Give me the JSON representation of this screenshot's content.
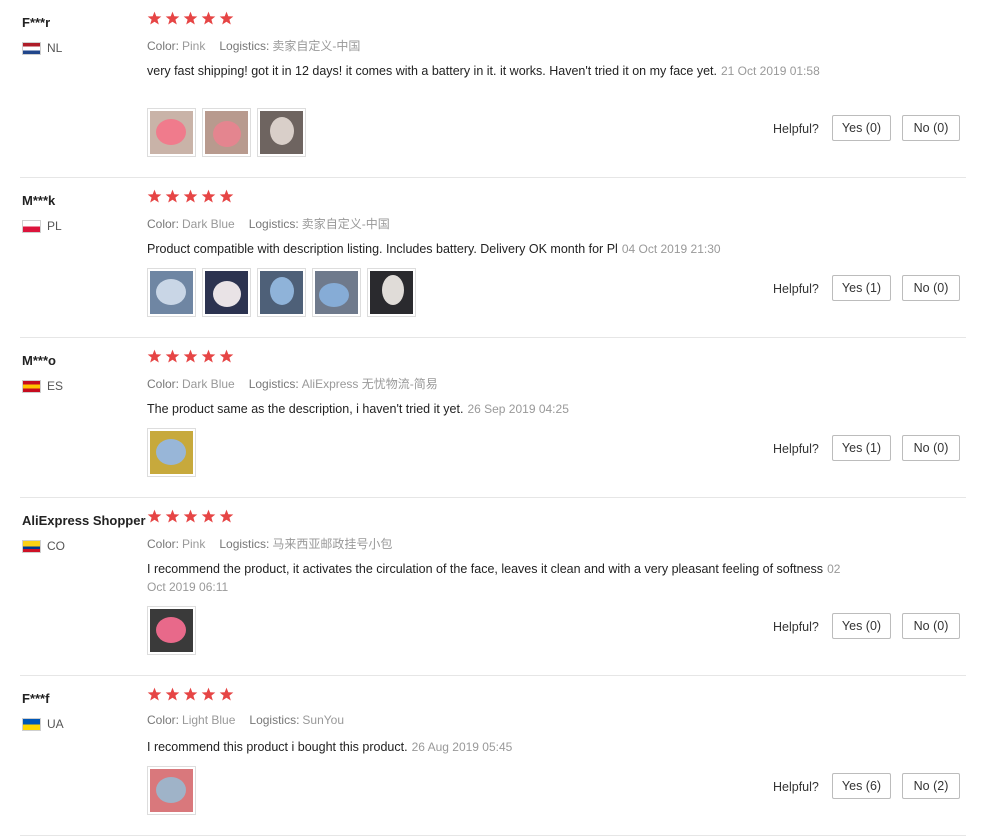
{
  "star_color": "#e64545",
  "helpful_label": "Helpful?",
  "reviews": [
    {
      "user": "F***r",
      "country": "NL",
      "flag_colors": [
        "#ae1c28",
        "#ffffff",
        "#21468b"
      ],
      "color_label": "Color:",
      "color_value": "Pink",
      "logistics_label": "Logistics:",
      "logistics_value": "卖家自定义-中国",
      "text": "very fast shipping! got it in 12 days! it comes with a battery in it. it works. Haven't tried it on my face yet.",
      "date": "21 Oct 2019 01:58",
      "stars": 5,
      "yes_label": "Yes (0)",
      "no_label": "No (0)",
      "thumbs": [
        {
          "bg": "#c9b3a8",
          "fg": "#f07b8c",
          "name": "pink-brush-photo"
        },
        {
          "bg": "#b89a8e",
          "fg": "#e4858f",
          "name": "pink-brush-photo"
        },
        {
          "bg": "#6e6460",
          "fg": "#d9cfc9",
          "name": "package-photo"
        }
      ]
    },
    {
      "user": "M***k",
      "country": "PL",
      "flag_colors": [
        "#ffffff",
        "#dc143c"
      ],
      "color_label": "Color:",
      "color_value": "Dark Blue",
      "logistics_label": "Logistics:",
      "logistics_value": "卖家自定义-中国",
      "text": "Product compatible with description listing. Includes battery. Delivery OK month for Pl",
      "date": "04 Oct 2019 21:30",
      "stars": 5,
      "yes_label": "Yes (1)",
      "no_label": "No (0)",
      "thumbs": [
        {
          "bg": "#6f86a3",
          "fg": "#c9d6e6",
          "name": "blue-brush-photo"
        },
        {
          "bg": "#2c3350",
          "fg": "#e9e3e6",
          "name": "box-photo"
        },
        {
          "bg": "#4e6078",
          "fg": "#8fb3d9",
          "name": "blue-brush-photo"
        },
        {
          "bg": "#6f7a8c",
          "fg": "#86acd6",
          "name": "blue-brush-photo"
        },
        {
          "bg": "#2a2a2e",
          "fg": "#e0dcd8",
          "name": "brush-back-photo"
        }
      ]
    },
    {
      "user": "M***o",
      "country": "ES",
      "flag_colors": [
        "#c60b1e",
        "#ffc400",
        "#c60b1e"
      ],
      "color_label": "Color:",
      "color_value": "Dark Blue",
      "logistics_label": "Logistics:",
      "logistics_value": "AliExpress 无忧物流-简易",
      "text": "The product same as the description, i haven't tried it yet.",
      "date": "26 Sep 2019 04:25",
      "stars": 5,
      "yes_label": "Yes (1)",
      "no_label": "No (0)",
      "thumbs": [
        {
          "bg": "#c7a93c",
          "fg": "#98b6d8",
          "name": "blue-brush-photo"
        }
      ]
    },
    {
      "user": "AliExpress Shopper",
      "country": "CO",
      "flag_colors": [
        "#fcd116",
        "#003893",
        "#ce1126"
      ],
      "color_label": "Color:",
      "color_value": "Pink",
      "logistics_label": "Logistics:",
      "logistics_value": "马来西亚邮政挂号小包",
      "text": "I recommend the product, it activates the circulation of the face, leaves it clean and with a very pleasant feeling of softness",
      "date": "02 Oct 2019 06:11",
      "stars": 5,
      "yes_label": "Yes (0)",
      "no_label": "No (0)",
      "thumbs": [
        {
          "bg": "#3a3a3a",
          "fg": "#e8698a",
          "name": "pink-brush-photo"
        }
      ]
    },
    {
      "user": "F***f",
      "country": "UA",
      "flag_colors": [
        "#0057b7",
        "#ffd700"
      ],
      "color_label": "Color:",
      "color_value": "Light Blue",
      "logistics_label": "Logistics:",
      "logistics_value": "SunYou",
      "text": "I recommend this product i bought this product.",
      "date": "26 Aug 2019 05:45",
      "stars": 5,
      "yes_label": "Yes (6)",
      "no_label": "No (2)",
      "thumbs": [
        {
          "bg": "#d9787c",
          "fg": "#9fb3c8",
          "name": "light-blue-brush-photo"
        }
      ]
    }
  ]
}
